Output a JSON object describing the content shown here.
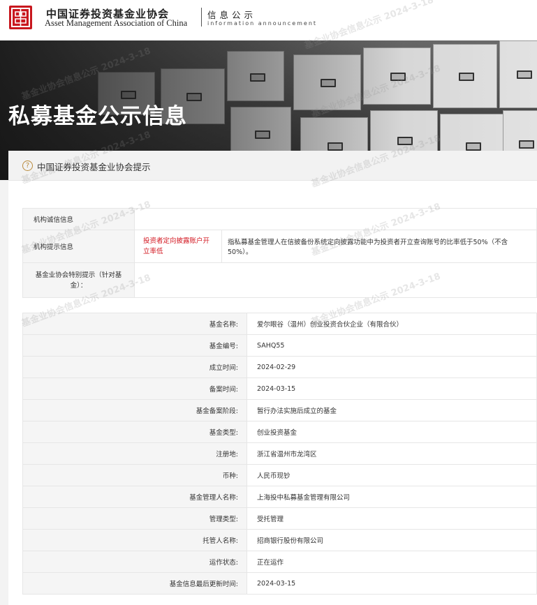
{
  "header": {
    "org_name_cn": "中国证券投资基金业协会",
    "org_name_en": "Asset Management Association of China",
    "section_cn": "信息公示",
    "section_en": "information announcement"
  },
  "banner": {
    "title": "私募基金公示信息"
  },
  "tip": {
    "icon": "question-circle-icon",
    "text": "中国证券投资基金业协会提示"
  },
  "integrity": {
    "rows": [
      {
        "label": "机构诚信信息",
        "tag": "",
        "detail": ""
      },
      {
        "label": "机构提示信息",
        "tag": "投资者定向披露账户开立率低",
        "detail": "指私募基金管理人在信披备份系统定向披露功能中为投资者开立查询账号的比率低于50%（不含50%）。"
      },
      {
        "label": "基金业协会特别提示（针对基金）：",
        "tag": "",
        "detail": ""
      }
    ]
  },
  "fund_info": {
    "rows": [
      {
        "label": "基金名称:",
        "value": "爱尔眼谷（温州）创业投资合伙企业（有限合伙）"
      },
      {
        "label": "基金编号:",
        "value": "SAHQ55"
      },
      {
        "label": "成立时间:",
        "value": "2024-02-29"
      },
      {
        "label": "备案时间:",
        "value": "2024-03-15"
      },
      {
        "label": "基金备案阶段:",
        "value": "暂行办法实施后成立的基金"
      },
      {
        "label": "基金类型:",
        "value": "创业投资基金"
      },
      {
        "label": "注册地:",
        "value": "浙江省温州市龙湾区"
      },
      {
        "label": "币种:",
        "value": "人民币现钞"
      },
      {
        "label": "基金管理人名称:",
        "value": "上海投中私募基金管理有限公司"
      },
      {
        "label": "管理类型:",
        "value": "受托管理"
      },
      {
        "label": "托管人名称:",
        "value": "招商银行股份有限公司"
      },
      {
        "label": "运作状态:",
        "value": "正在运作"
      },
      {
        "label": "基金信息最后更新时间:",
        "value": "2024-03-15"
      }
    ]
  },
  "watermark": "基金业协会信息公示 2024-3-18",
  "colors": {
    "brand_red": "#c8171e",
    "alert_red": "#d2141e"
  }
}
